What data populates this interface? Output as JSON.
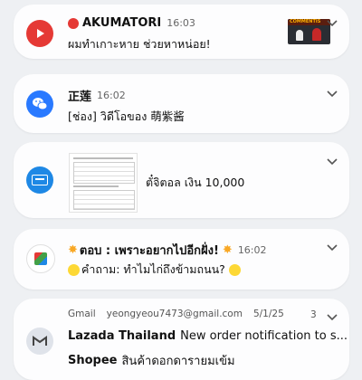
{
  "notifications": [
    {
      "app_icon": "youtube-icon",
      "sender_icon": "red-circle-emoji",
      "sender": "AKUMATORI",
      "time": "16:03",
      "body": "ผมทำเกาะหาย ช่วยหาหน่อย!",
      "thumbnail": "video-thumbnail",
      "thumbnail_text": "COMMENTIS",
      "colors": {
        "icon_bg": "#e53935"
      }
    },
    {
      "app_icon": "wechat-icon",
      "sender": "正莲",
      "time": "16:02",
      "body": "[ช่อง] วิดีโอของ 萌紫酱",
      "colors": {
        "icon_bg": "#2979ff"
      }
    },
    {
      "app_icon": "bank-app-icon",
      "thumbnail": "document-thumbnail",
      "body": "ตั๋จิตอล เงิน 10,000",
      "colors": {
        "icon_bg": "#1e88e5"
      }
    },
    {
      "app_icon": "game-app-icon",
      "sender_prefix_icon": "sparkle-emoji",
      "sender": "ตอบ : เพราะอยากไปอีกฝั่ง!",
      "sender_suffix_icon": "sparkle-emoji",
      "time": "16:02",
      "body_prefix_icon": "laughing-emoji",
      "body": "คำถาม: ทำไมไก่ถึงข้ามถนน?",
      "body_suffix_icon": "laughing-emoji"
    },
    {
      "app_icon": "gmail-icon",
      "app_name": "Gmail",
      "account": "yeongyeou7473@gmail.com",
      "time": "5/1/25",
      "count": "3",
      "line1_sender": "Lazada Thailand",
      "line1_text": "New order notification to s...",
      "line2_sender": "Shopee",
      "line2_text": "สินค้าดอกดารายมเข้ม"
    }
  ]
}
